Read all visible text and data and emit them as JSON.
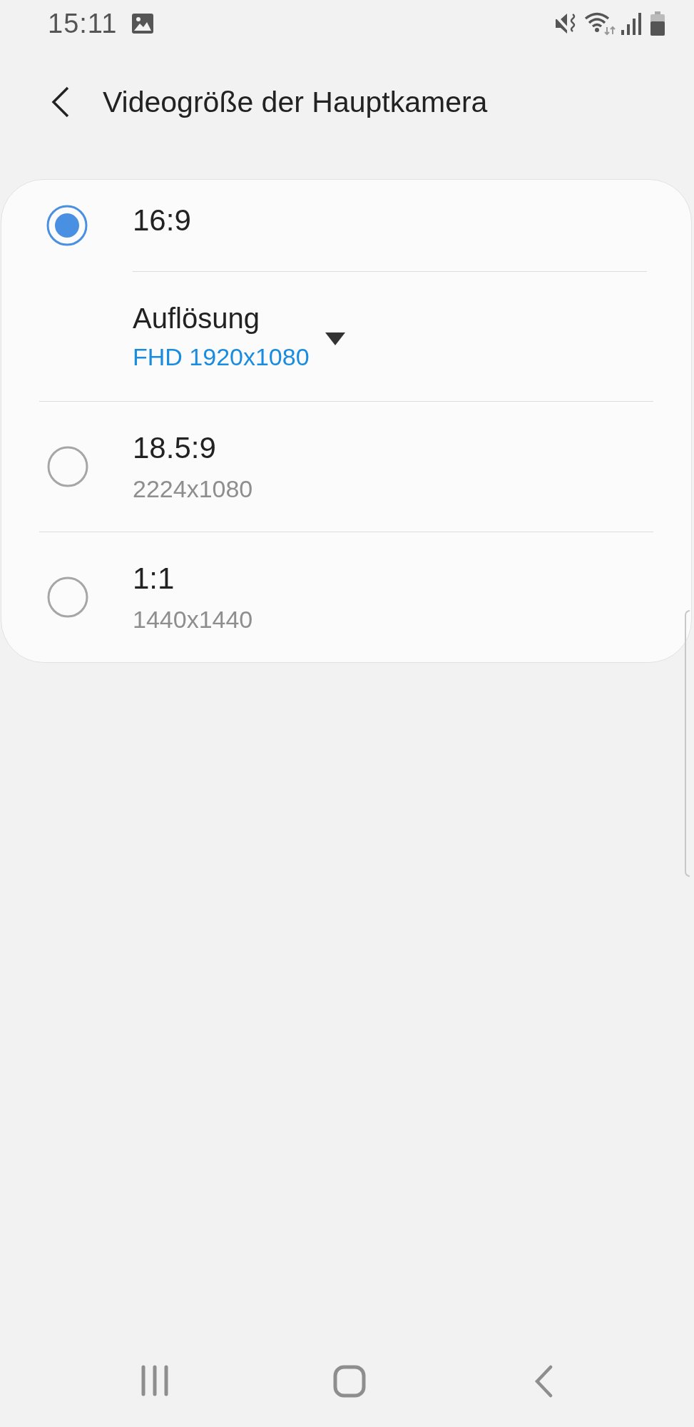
{
  "status_bar": {
    "time": "15:11"
  },
  "header": {
    "title": "Videogröße der Hauptkamera"
  },
  "options": [
    {
      "kind": "with-setting",
      "label": "16:9",
      "selected": true,
      "setting": {
        "label": "Auflösung",
        "value": "FHD 1920x1080"
      }
    },
    {
      "kind": "plain",
      "label": "18.5:9",
      "detail": "2224x1080",
      "selected": false
    },
    {
      "kind": "plain",
      "label": "1:1",
      "detail": "1440x1440",
      "selected": false
    }
  ]
}
